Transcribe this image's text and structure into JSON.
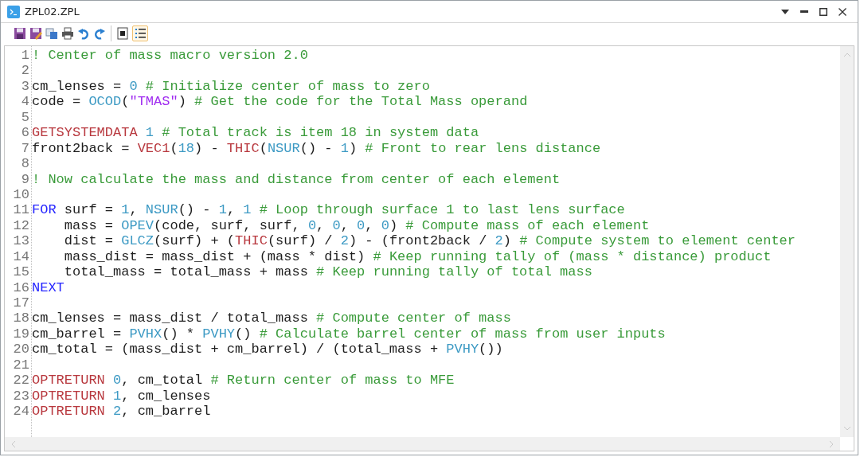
{
  "window": {
    "title": "ZPL02.ZPL"
  },
  "toolbar": {
    "line_numbers_button": {
      "on": true
    }
  },
  "editor": {
    "lines": [
      {
        "number": "1",
        "tokens": [
          {
            "text": "! Center of mass macro version 2.0",
            "kind": "comment"
          }
        ]
      },
      {
        "number": "2"
      },
      {
        "number": "3",
        "tokens": [
          {
            "text": "cm_lenses = ",
            "kind": "plain"
          },
          {
            "text": "0",
            "kind": "number"
          },
          {
            "text": " # Initialize center of mass to zero",
            "kind": "comment"
          }
        ]
      },
      {
        "number": "4",
        "tokens": [
          {
            "text": "code = ",
            "kind": "plain"
          },
          {
            "text": "OCOD",
            "kind": "function"
          },
          {
            "text": "(",
            "kind": "plain"
          },
          {
            "text": "\"TMAS\"",
            "kind": "string"
          },
          {
            "text": ") ",
            "kind": "plain"
          },
          {
            "text": "# Get the code for the Total Mass operand",
            "kind": "comment"
          }
        ]
      },
      {
        "number": "5"
      },
      {
        "number": "6",
        "tokens": [
          {
            "text": "GETSYSTEMDATA",
            "kind": "command"
          },
          {
            "text": " 1",
            "kind": "number"
          },
          {
            "text": " # Total track is item 18 in system data",
            "kind": "comment"
          }
        ]
      },
      {
        "number": "7",
        "tokens": [
          {
            "text": "front2back = ",
            "kind": "plain"
          },
          {
            "text": "VEC1",
            "kind": "command"
          },
          {
            "text": "(",
            "kind": "plain"
          },
          {
            "text": "18",
            "kind": "number"
          },
          {
            "text": ") - ",
            "kind": "plain"
          },
          {
            "text": "THIC",
            "kind": "command"
          },
          {
            "text": "(",
            "kind": "plain"
          },
          {
            "text": "NSUR",
            "kind": "function"
          },
          {
            "text": "() - ",
            "kind": "plain"
          },
          {
            "text": "1",
            "kind": "number"
          },
          {
            "text": ") ",
            "kind": "plain"
          },
          {
            "text": "# Front to rear lens distance",
            "kind": "comment"
          }
        ]
      },
      {
        "number": "8"
      },
      {
        "number": "9",
        "tokens": [
          {
            "text": "! Now calculate the mass and distance from center of each element",
            "kind": "comment"
          }
        ]
      },
      {
        "number": "10"
      },
      {
        "number": "11",
        "tokens": [
          {
            "text": "FOR",
            "kind": "keyword"
          },
          {
            "text": " surf = ",
            "kind": "plain"
          },
          {
            "text": "1",
            "kind": "number"
          },
          {
            "text": ", ",
            "kind": "plain"
          },
          {
            "text": "NSUR",
            "kind": "function"
          },
          {
            "text": "() - ",
            "kind": "plain"
          },
          {
            "text": "1",
            "kind": "number"
          },
          {
            "text": ", ",
            "kind": "plain"
          },
          {
            "text": "1",
            "kind": "number"
          },
          {
            "text": " # Loop through surface 1 to last lens surface",
            "kind": "comment"
          }
        ]
      },
      {
        "number": "12",
        "tokens": [
          {
            "text": "    mass = ",
            "kind": "plain"
          },
          {
            "text": "OPEV",
            "kind": "function"
          },
          {
            "text": "(code, surf, surf, ",
            "kind": "plain"
          },
          {
            "text": "0",
            "kind": "number"
          },
          {
            "text": ", ",
            "kind": "plain"
          },
          {
            "text": "0",
            "kind": "number"
          },
          {
            "text": ", ",
            "kind": "plain"
          },
          {
            "text": "0",
            "kind": "number"
          },
          {
            "text": ", ",
            "kind": "plain"
          },
          {
            "text": "0",
            "kind": "number"
          },
          {
            "text": ") ",
            "kind": "plain"
          },
          {
            "text": "# Compute mass of each element",
            "kind": "comment"
          }
        ]
      },
      {
        "number": "13",
        "tokens": [
          {
            "text": "    dist = ",
            "kind": "plain"
          },
          {
            "text": "GLCZ",
            "kind": "function"
          },
          {
            "text": "(surf) + (",
            "kind": "plain"
          },
          {
            "text": "THIC",
            "kind": "command"
          },
          {
            "text": "(surf) / ",
            "kind": "plain"
          },
          {
            "text": "2",
            "kind": "number"
          },
          {
            "text": ") - (front2back / ",
            "kind": "plain"
          },
          {
            "text": "2",
            "kind": "number"
          },
          {
            "text": ") ",
            "kind": "plain"
          },
          {
            "text": "# Compute system to element center",
            "kind": "comment"
          }
        ]
      },
      {
        "number": "14",
        "tokens": [
          {
            "text": "    mass_dist = mass_dist + (mass * dist) ",
            "kind": "plain"
          },
          {
            "text": "# Keep running tally of (mass * distance) product",
            "kind": "comment"
          }
        ]
      },
      {
        "number": "15",
        "tokens": [
          {
            "text": "    total_mass = total_mass + mass ",
            "kind": "plain"
          },
          {
            "text": "# Keep running tally of total mass",
            "kind": "comment"
          }
        ]
      },
      {
        "number": "16",
        "tokens": [
          {
            "text": "NEXT",
            "kind": "keyword"
          }
        ]
      },
      {
        "number": "17"
      },
      {
        "number": "18",
        "tokens": [
          {
            "text": "cm_lenses = mass_dist / total_mass ",
            "kind": "plain"
          },
          {
            "text": "# Compute center of mass",
            "kind": "comment"
          }
        ]
      },
      {
        "number": "19",
        "tokens": [
          {
            "text": "cm_barrel = ",
            "kind": "plain"
          },
          {
            "text": "PVHX",
            "kind": "function"
          },
          {
            "text": "() * ",
            "kind": "plain"
          },
          {
            "text": "PVHY",
            "kind": "function"
          },
          {
            "text": "() ",
            "kind": "plain"
          },
          {
            "text": "# Calculate barrel center of mass from user inputs",
            "kind": "comment"
          }
        ]
      },
      {
        "number": "20",
        "tokens": [
          {
            "text": "cm_total = (mass_dist + cm_barrel) / (total_mass + ",
            "kind": "plain"
          },
          {
            "text": "PVHY",
            "kind": "function"
          },
          {
            "text": "())",
            "kind": "plain"
          }
        ]
      },
      {
        "number": "21"
      },
      {
        "number": "22",
        "tokens": [
          {
            "text": "OPTRETURN",
            "kind": "command"
          },
          {
            "text": " 0",
            "kind": "number"
          },
          {
            "text": ", cm_total ",
            "kind": "plain"
          },
          {
            "text": "# Return center of mass to MFE",
            "kind": "comment"
          }
        ]
      },
      {
        "number": "23",
        "tokens": [
          {
            "text": "OPTRETURN",
            "kind": "command"
          },
          {
            "text": " 1",
            "kind": "number"
          },
          {
            "text": ", cm_lenses",
            "kind": "plain"
          }
        ]
      },
      {
        "number": "24",
        "tokens": [
          {
            "text": "OPTRETURN",
            "kind": "command"
          },
          {
            "text": " 2",
            "kind": "number"
          },
          {
            "text": ", cm_barrel",
            "kind": "plain"
          }
        ]
      }
    ]
  }
}
